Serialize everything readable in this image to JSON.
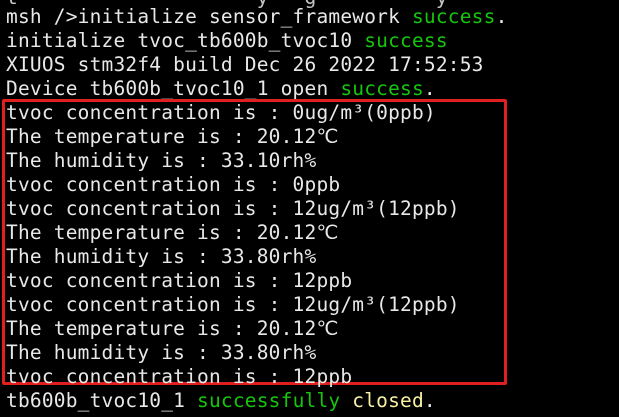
{
  "terminal": {
    "clipped_top_line": "t                    y   g          y",
    "lines_before": [
      {
        "text": "msh />initialize sensor_framework ",
        "status": "success",
        "tail": "."
      },
      {
        "text": "initialize tvoc_tb600b_tvoc10 ",
        "status": "success",
        "tail": ""
      },
      {
        "text": "XIUOS stm32f4 build Dec 26 2022 17:52:53",
        "status": "",
        "tail": ""
      },
      {
        "text": "Device tb600b_tvoc10_1 open ",
        "status": "success",
        "tail": "."
      }
    ],
    "highlighted_lines": [
      "tvoc concentration is : 0ug/m³(0ppb)",
      "The temperature is : 20.12℃",
      "The humidity is : 33.10rh%",
      "tvoc concentration is : 0ppb",
      "tvoc concentration is : 12ug/m³(12ppb)",
      "The temperature is : 20.12℃",
      "The humidity is : 33.80rh%",
      "tvoc concentration is : 12ppb",
      "tvoc concentration is : 12ug/m³(12ppb)",
      "The temperature is : 20.12℃",
      "The humidity is : 33.80rh%",
      "tvoc concentration is : 12ppb"
    ],
    "last_line": {
      "device": "tb600b_tvoc10_1 ",
      "status1": "successfully",
      "space": " ",
      "status2": "closed",
      "tail": "."
    }
  },
  "colors": {
    "background": "#000000",
    "text": "#e8e8e8",
    "success": "#16c60c",
    "closed": "#f9f1a5",
    "highlight_border": "#e02020"
  }
}
